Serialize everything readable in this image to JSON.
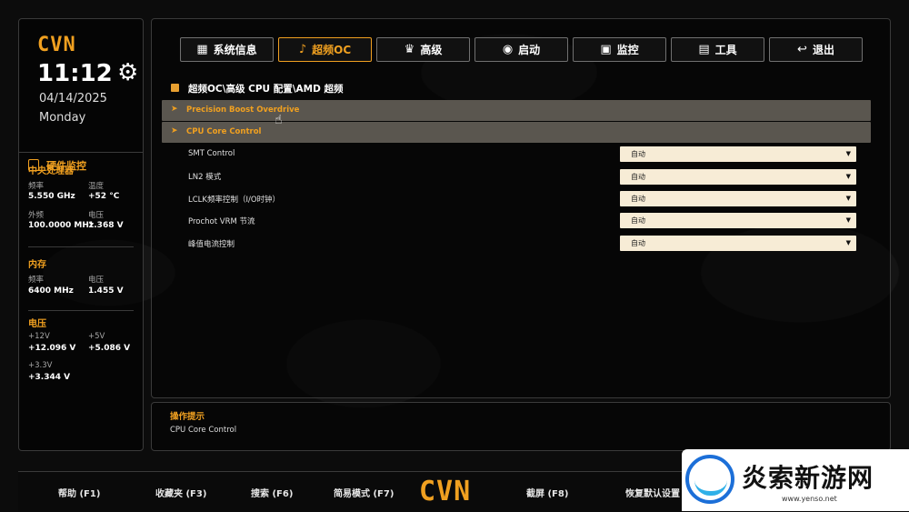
{
  "sidebar": {
    "logo": "CVN",
    "time": "11:12",
    "date": "04/14/2025",
    "weekday": "Monday",
    "monitor_title": "硬件监控",
    "cpu": {
      "title": "中央处理器",
      "freq_label": "频率",
      "freq_value": "5.550 GHz",
      "temp_label": "温度",
      "temp_value": "+52 °C",
      "bclk_label": "外频",
      "bclk_value": "100.0000 MHz",
      "volt_label": "电压",
      "volt_value": "1.368 V"
    },
    "memory": {
      "title": "内存",
      "freq_label": "频率",
      "freq_value": "6400 MHz",
      "volt_label": "电压",
      "volt_value": "1.455 V"
    },
    "voltage": {
      "title": "电压",
      "v12_label": "+12V",
      "v12_value": "+12.096 V",
      "v5_label": "+5V",
      "v5_value": "+5.086 V",
      "v33_label": "+3.3V",
      "v33_value": "+3.344 V"
    }
  },
  "tabs": [
    {
      "label": "系统信息",
      "icon": "grid-icon",
      "glyph": "▦"
    },
    {
      "label": "超频OC",
      "icon": "bell-icon",
      "glyph": "🔔"
    },
    {
      "label": "高级",
      "icon": "crown-icon",
      "glyph": "♛"
    },
    {
      "label": "启动",
      "icon": "power-icon",
      "glyph": "⏻"
    },
    {
      "label": "监控",
      "icon": "monitor-chart-icon",
      "glyph": "▣"
    },
    {
      "label": "工具",
      "icon": "toolbox-icon",
      "glyph": "▤"
    },
    {
      "label": "退出",
      "icon": "back-arrow-icon",
      "glyph": "↩"
    }
  ],
  "active_tab": "超频OC",
  "breadcrumb": "超频OC\\高级 CPU 配置\\AMD 超频",
  "sections": [
    {
      "label": "Precision Boost Overdrive"
    },
    {
      "label": "CPU Core Control"
    }
  ],
  "options": [
    {
      "label": "SMT Control",
      "value": "自动"
    },
    {
      "label": "LN2 模式",
      "value": "自动"
    },
    {
      "label": "LCLK频率控制（I/O时钟）",
      "value": "自动"
    },
    {
      "label": "Prochot VRM 节流",
      "value": "自动"
    },
    {
      "label": "峰值电流控制",
      "value": "自动"
    }
  ],
  "hint": {
    "title": "操作提示",
    "text": "CPU Core Control"
  },
  "bottom_bar": {
    "help": "帮助 (F1)",
    "favorites": "收藏夹 (F3)",
    "search": "搜索 (F6)",
    "easy_mode": "简易模式 (F7)",
    "logo": "CVN",
    "screenshot": "截屏 (F8)",
    "restore_defaults": "恢复默认设置"
  },
  "watermark": {
    "text": "炎索新游网",
    "url": "www.yenso.net"
  },
  "colors": {
    "accent": "#f0a020",
    "row_highlight": "#5a564f",
    "select_bg": "#f7ecd6"
  }
}
